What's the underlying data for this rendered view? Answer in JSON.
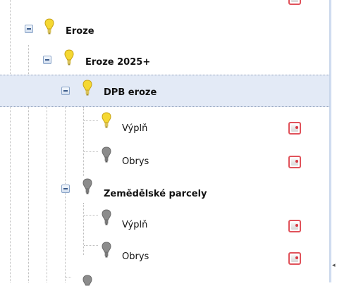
{
  "tree": {
    "nodes": [
      {
        "label": "Eroze",
        "bulb": "bulb-on-icon",
        "expanded": true,
        "bold": true
      },
      {
        "label": "Eroze 2025+",
        "bulb": "bulb-on-icon",
        "expanded": true,
        "bold": true
      },
      {
        "label": "DPB eroze",
        "bulb": "bulb-on-icon",
        "expanded": true,
        "bold": true,
        "selected": true
      },
      {
        "label": "Výplň",
        "bulb": "bulb-on-icon",
        "bold": false
      },
      {
        "label": "Obrys",
        "bulb": "bulb-off-icon",
        "bold": false
      },
      {
        "label": "Zemědělské parcely",
        "bulb": "bulb-off-icon",
        "expanded": true,
        "bold": true
      },
      {
        "label": "Výplň",
        "bulb": "bulb-off-icon",
        "bold": false
      },
      {
        "label": "Obrys",
        "bulb": "bulb-off-icon",
        "bold": false
      }
    ]
  },
  "colors": {
    "bulb_on": "#f5d833",
    "bulb_off": "#8c8c8c",
    "selection": "#e3eaf6",
    "map_button_border": "#e0525a"
  }
}
